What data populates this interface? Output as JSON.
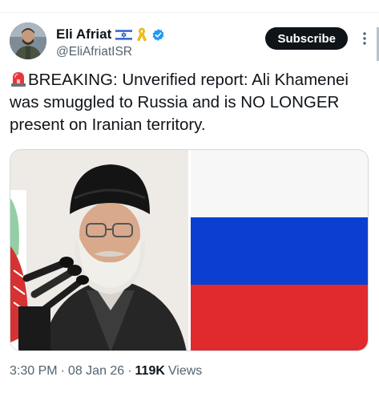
{
  "author": {
    "display_name": "Eli Afriat",
    "handle": "@EliAfriatISR",
    "badges": [
      "israel-flag-emoji",
      "yellow-ribbon-emoji",
      "verified-badge-icon"
    ]
  },
  "actions": {
    "subscribe_label": "Subscribe",
    "more_icon": "more-vertical-icon"
  },
  "post": {
    "emoji": "police-siren-emoji",
    "text": "BREAKING: Unverified report: Ali Khamenei was smuggled to Russia and is NO LONGER present on Iranian territory."
  },
  "media": {
    "left_image": "photo-of-cleric-at-microphones",
    "right_image": "russian-flag",
    "flag_colors": [
      "#f7f7f7",
      "#0c3fd1",
      "#e12a2e"
    ]
  },
  "meta": {
    "time": "3:30 PM",
    "sep1": "·",
    "date": "08 Jan 26",
    "sep2": "·",
    "views_count": "119K",
    "views_label": "Views"
  },
  "colors": {
    "text": "#0f1419",
    "secondary": "#536471",
    "verified": "#1d9bf0",
    "subscribe_bg": "#0f1419"
  }
}
